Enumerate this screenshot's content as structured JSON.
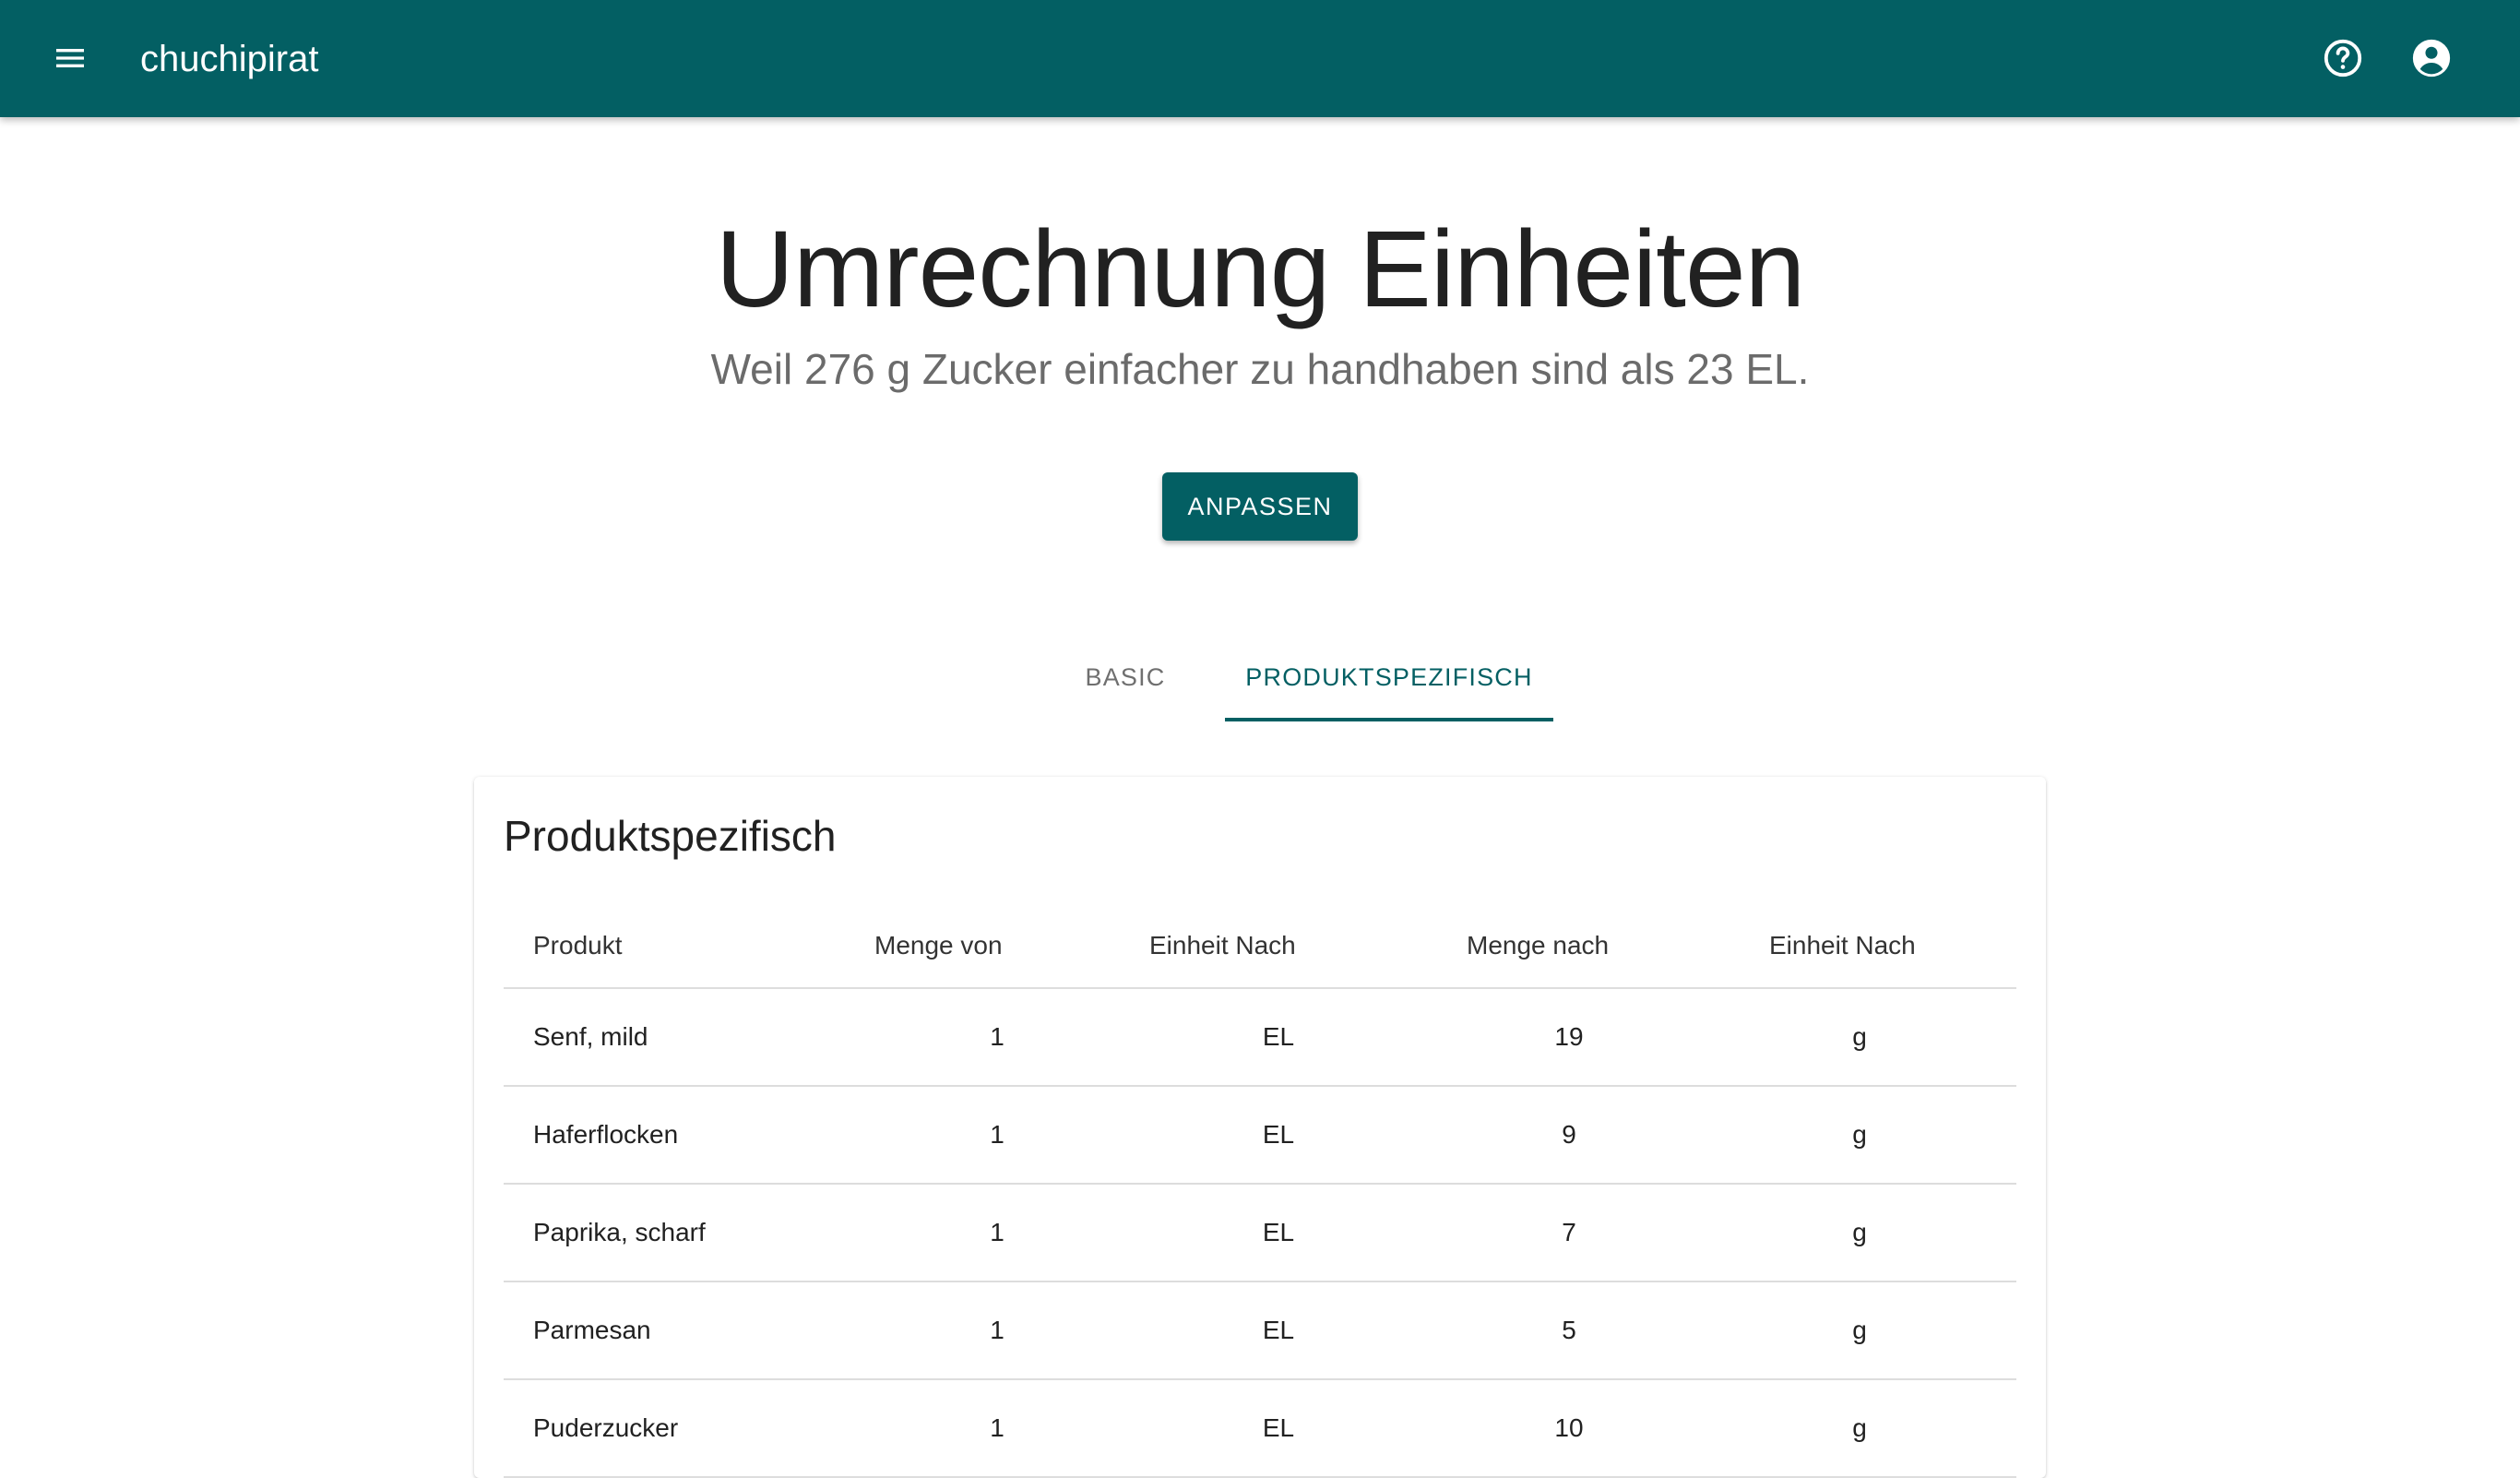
{
  "appbar": {
    "title": "chuchipirat",
    "background": "#035f63",
    "icons": [
      "menu-icon",
      "help-icon",
      "account-circle-icon"
    ]
  },
  "hero": {
    "title": "Umrechnung Einheiten",
    "subtitle": "Weil 276 g Zucker einfacher zu handhaben sind als 23 EL."
  },
  "actions": {
    "adjust_label": "ANPASSEN"
  },
  "tabs": [
    {
      "label": "BASIC",
      "active": false
    },
    {
      "label": "PRODUKTSPEZIFISCH",
      "active": true
    }
  ],
  "card": {
    "title": "Produktspezifisch",
    "columns": [
      "Produkt",
      "Menge von",
      "Einheit Nach",
      "Menge nach",
      "Einheit Nach"
    ],
    "rows": [
      {
        "product": "Senf, mild",
        "from_qty": "1",
        "from_unit": "EL",
        "to_qty": "19",
        "to_unit": "g"
      },
      {
        "product": "Haferflocken",
        "from_qty": "1",
        "from_unit": "EL",
        "to_qty": "9",
        "to_unit": "g"
      },
      {
        "product": "Paprika, scharf",
        "from_qty": "1",
        "from_unit": "EL",
        "to_qty": "7",
        "to_unit": "g"
      },
      {
        "product": "Parmesan",
        "from_qty": "1",
        "from_unit": "EL",
        "to_qty": "5",
        "to_unit": "g"
      },
      {
        "product": "Puderzucker",
        "from_qty": "1",
        "from_unit": "EL",
        "to_qty": "10",
        "to_unit": "g"
      }
    ]
  },
  "colors": {
    "primary": "#035f63",
    "text": "#212121",
    "muted": "#6b6b6b"
  }
}
